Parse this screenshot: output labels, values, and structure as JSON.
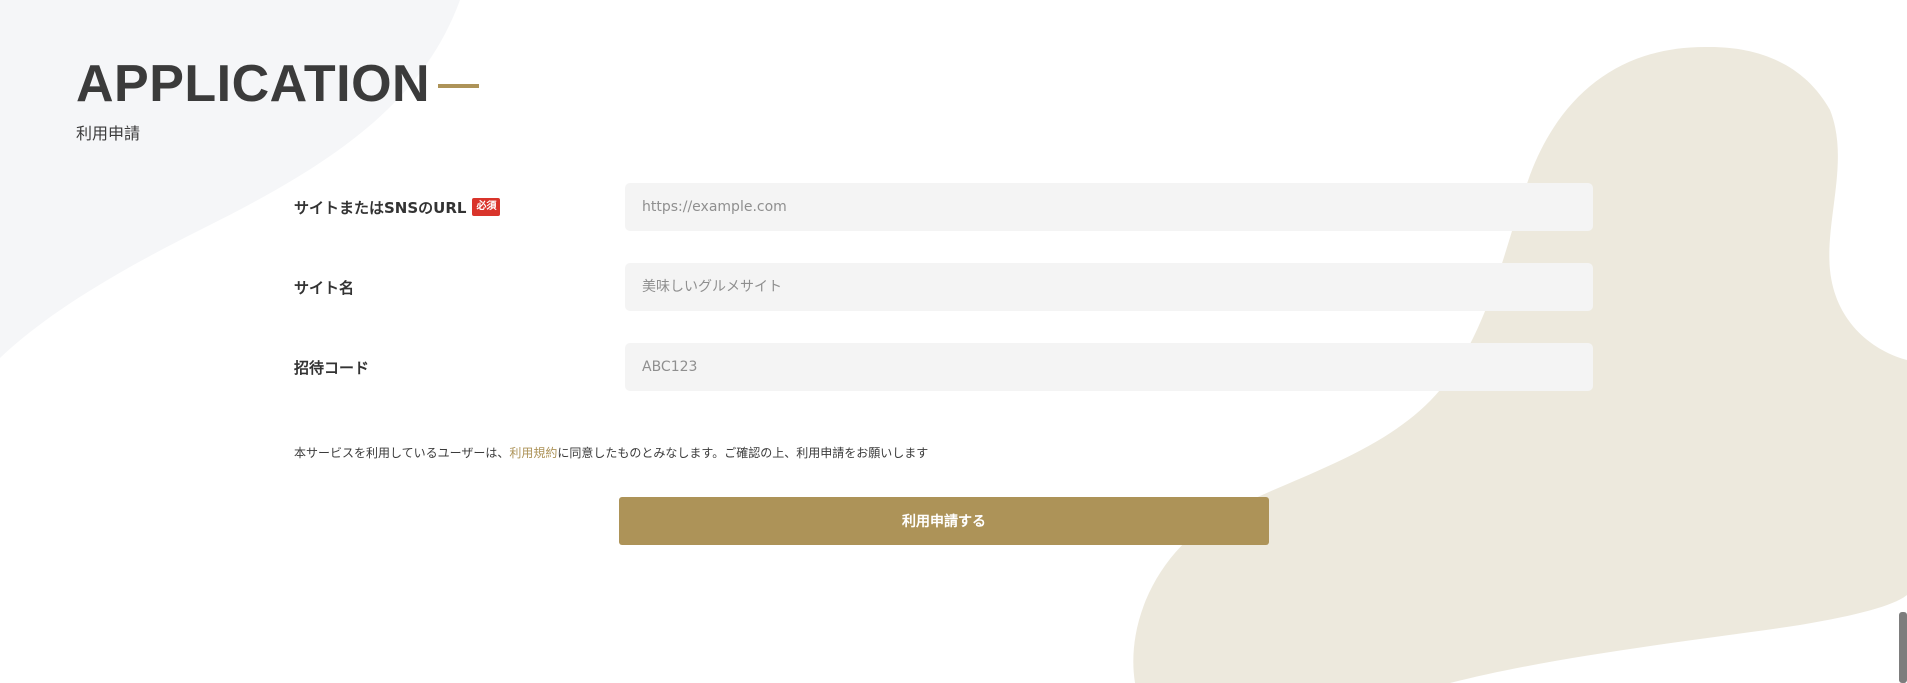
{
  "section": {
    "title": "APPLICATION",
    "subtitle": "利用申請"
  },
  "form": {
    "url_field": {
      "label": "サイトまたはSNSのURL",
      "required_badge": "必須",
      "placeholder": "https://example.com",
      "value": ""
    },
    "site_name_field": {
      "label": "サイト名",
      "placeholder": "美味しいグルメサイト",
      "value": ""
    },
    "invite_code_field": {
      "label": "招待コード",
      "placeholder": "ABC123",
      "value": ""
    }
  },
  "terms": {
    "before": "本サービスを利用しているユーザーは、",
    "link_text": "利用規約",
    "after": "に同意したものとみなします。ご確認の上、利用申請をお願いします"
  },
  "submit": {
    "label": "利用申請する"
  },
  "colors": {
    "accent": "#ad9358",
    "required": "#d9342b",
    "input_bg": "#f4f4f4",
    "blob_left": "#f5f6f8",
    "blob_right": "#ede9dd"
  }
}
